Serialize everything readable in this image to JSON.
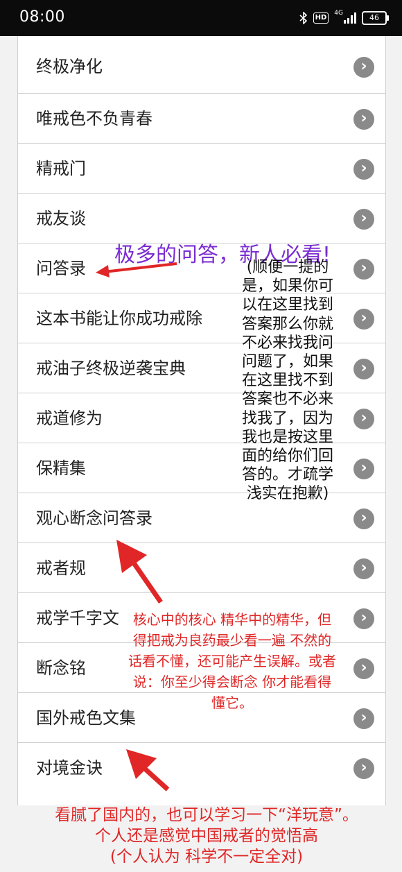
{
  "status_bar": {
    "time": "08:00",
    "icons": [
      "bluetooth-icon",
      "hd-icon",
      "signal-4g-icon",
      "battery-icon"
    ],
    "hd_label": "HD",
    "network_label": "4G",
    "battery_level": "46"
  },
  "list": {
    "items": [
      {
        "label": "终极净化"
      },
      {
        "label": "唯戒色不负青春"
      },
      {
        "label": "精戒门"
      },
      {
        "label": "戒友谈"
      },
      {
        "label": "问答录"
      },
      {
        "label": "这本书能让你成功戒除"
      },
      {
        "label": "戒油子终极逆袭宝典"
      },
      {
        "label": "戒道修为"
      },
      {
        "label": "保精集"
      },
      {
        "label": "观心断念问答录"
      },
      {
        "label": "戒者规"
      },
      {
        "label": "戒学千字文"
      },
      {
        "label": "断念铭"
      },
      {
        "label": "国外戒色文集"
      },
      {
        "label": "对境金诀"
      }
    ],
    "chevron_icon": "chevron-right-icon"
  },
  "annotations": {
    "purple": "极多的问答，新人必看!",
    "black": "(顺便一提的是，如果你可以在这里找到答案那么你就不必来找我问问题了，如果在这里找不到答案也不必来找我了，因为我也是按这里面的给你们回答的。才疏学浅实在抱歉)",
    "red_core": "核心中的核心 精华中的精华，但得把戒为良药最少看一遍 不然的话看不懂，还可能产生误解。或者说：你至少得会断念 你才能看得懂它。",
    "red_foreign_1": "看腻了国内的，也可以学习一下“洋玩意”。",
    "red_foreign_2": "个人还是感觉中国戒者的觉悟高",
    "red_foreign_3": "(个人认为 科学不一定全对)"
  },
  "colors": {
    "annotation_purple": "#7b2dd1",
    "annotation_red": "#e02626",
    "chevron_gray": "#8a8a8a"
  }
}
